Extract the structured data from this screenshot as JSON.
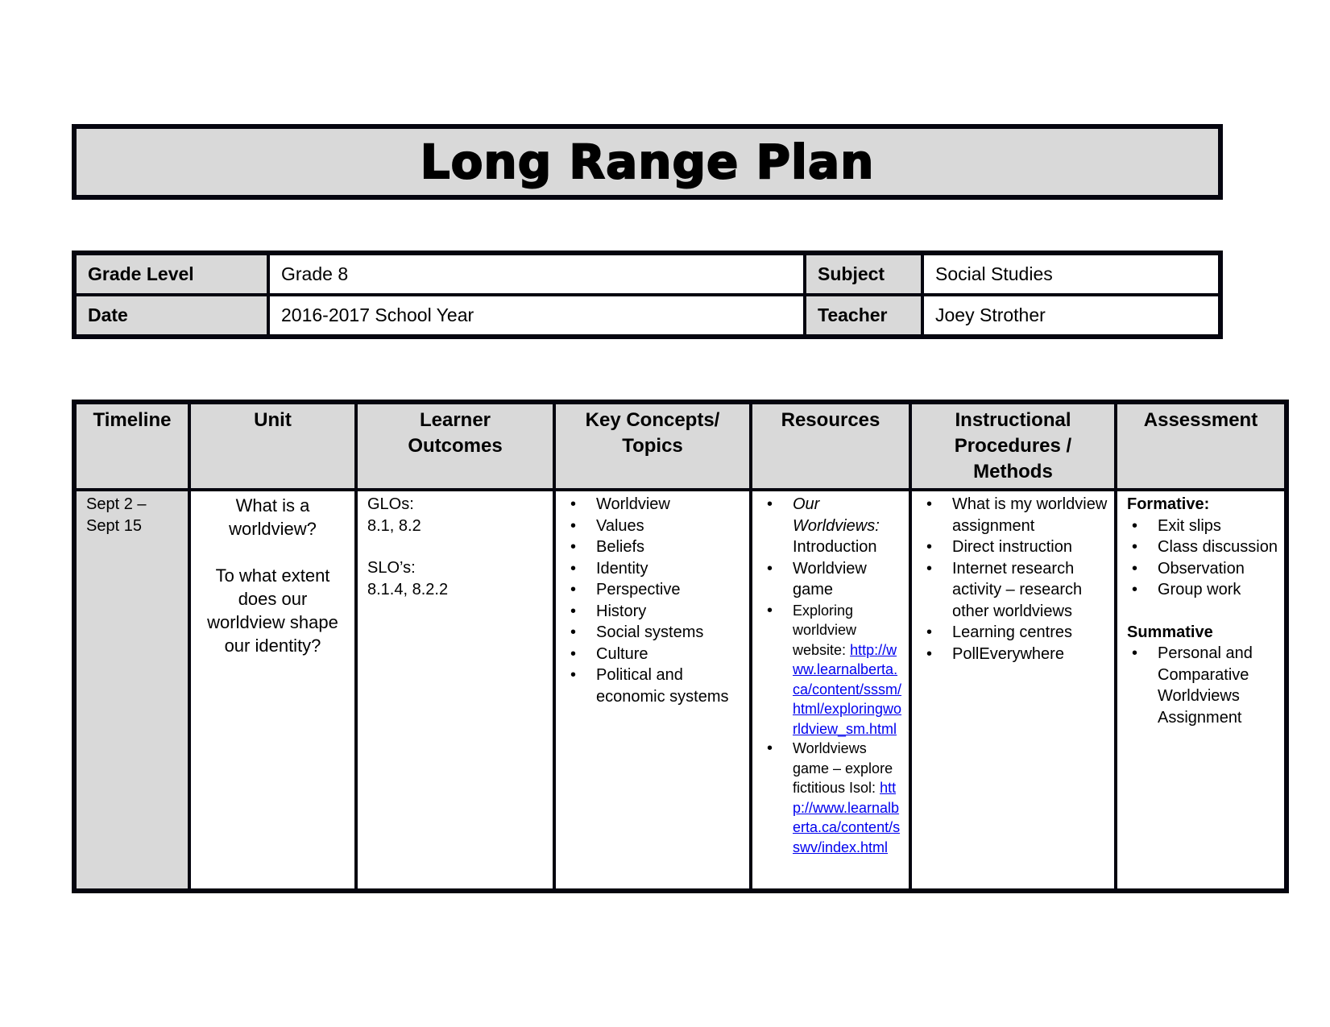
{
  "title": "Long Range Plan",
  "info": {
    "grade_level_label": "Grade Level",
    "grade_level_value": "Grade 8",
    "subject_label": "Subject",
    "subject_value": "Social Studies",
    "date_label": "Date",
    "date_value": "2016-2017 School Year",
    "teacher_label": "Teacher",
    "teacher_value": "Joey Strother"
  },
  "plan": {
    "headers": [
      "Timeline",
      "Unit",
      "Learner Outcomes",
      "Key Concepts/ Topics",
      "Resources",
      "Instructional Procedures / Methods",
      "Assessment"
    ],
    "rows": [
      {
        "timeline_line1": "Sept 2 –",
        "timeline_line2": "Sept 15",
        "unit_q1": "What is a worldview?",
        "unit_q2": "To what extent does our worldview shape our identity?",
        "glos_label": "GLOs:",
        "glos_value": "8.1, 8.2",
        "slos_label": "SLO’s:",
        "slos_value": "8.1.4, 8.2.2",
        "key_concepts": [
          "Worldview",
          "Values",
          "Beliefs",
          "Identity",
          "Perspective",
          "History",
          "Social systems",
          "Culture",
          "Political and economic systems"
        ],
        "resources": {
          "r1_italic": "Our Worldviews:",
          "r1_text": "Introduction",
          "r2": "Worldview game",
          "r3_text": "Exploring worldview website:",
          "r3_link": "http://www.learnalberta.ca/content/sssm/html/exploringworldview_sm.html",
          "r4_text": "Worldviews game – explore fictitious Isol:",
          "r4_link": "http://www.learnalberta.ca/content/sswv/index.html"
        },
        "methods": [
          "What is my worldview assignment",
          "Direct instruction",
          "Internet research activity – research other worldviews",
          "Learning centres",
          "PollEverywhere"
        ],
        "assessment": {
          "formative_label": "Formative:",
          "formative": [
            "Exit slips",
            "Class discussion",
            "Observation",
            "Group work"
          ],
          "summative_label": "Summative",
          "summative": [
            "Personal and Comparative Worldviews Assignment"
          ]
        }
      }
    ]
  },
  "colors": {
    "header_fill": "#d9d9d9",
    "border": "#05050f",
    "link": "#0000ee"
  }
}
